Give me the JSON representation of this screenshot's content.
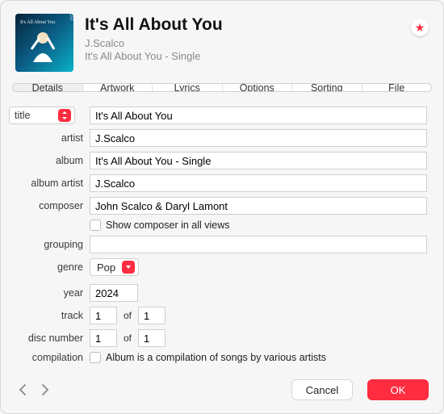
{
  "header": {
    "title": "It's All About You",
    "artist": "J.Scalco",
    "album_line": "It's All About You - Single"
  },
  "tabs": [
    "Details",
    "Artwork",
    "Lyrics",
    "Options",
    "Sorting",
    "File"
  ],
  "active_tab": 0,
  "labels": {
    "title": "title",
    "artist": "artist",
    "album": "album",
    "album_artist": "album artist",
    "composer": "composer",
    "grouping": "grouping",
    "genre": "genre",
    "year": "year",
    "track": "track",
    "disc": "disc number",
    "compilation": "compilation",
    "of": "of",
    "show_composer": "Show composer in all views",
    "compilation_text": "Album is a compilation of songs by various artists"
  },
  "fields": {
    "title_selector": "title",
    "title": "It's All About You",
    "artist": "J.Scalco",
    "album": "It's All About You - Single",
    "album_artist": "J.Scalco",
    "composer": "John Scalco & Daryl Lamont",
    "show_composer_checked": false,
    "grouping": "",
    "genre": "Pop",
    "year": "2024",
    "track_no": "1",
    "track_total": "1",
    "disc_no": "1",
    "disc_total": "1",
    "compilation_checked": false
  },
  "footer": {
    "cancel": "Cancel",
    "ok": "OK"
  },
  "colors": {
    "accent": "#ff2d3f"
  }
}
